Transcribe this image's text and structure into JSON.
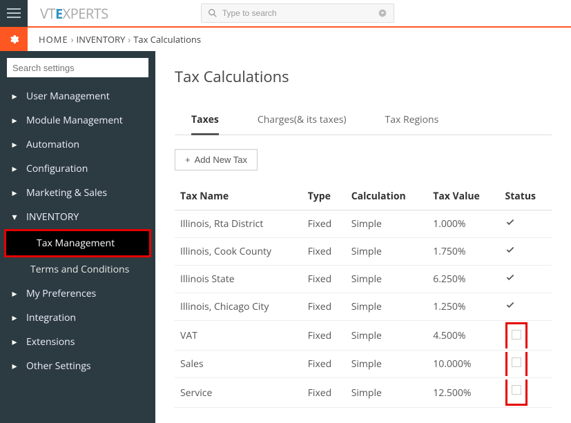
{
  "topbar": {
    "logo_pre": "VT",
    "logo_e": "E",
    "logo_post": "XPERTS",
    "search_placeholder": "Type to search"
  },
  "breadcrumb": {
    "home": "HOME",
    "l1": "INVENTORY",
    "l2": "Tax Calculations"
  },
  "sidebar": {
    "search_placeholder": "Search settings",
    "items": [
      {
        "label": "User Management",
        "expanded": false
      },
      {
        "label": "Module Management",
        "expanded": false
      },
      {
        "label": "Automation",
        "expanded": false
      },
      {
        "label": "Configuration",
        "expanded": false
      },
      {
        "label": "Marketing & Sales",
        "expanded": false
      },
      {
        "label": "INVENTORY",
        "expanded": true,
        "children": [
          {
            "label": "Tax Management",
            "active": true
          },
          {
            "label": "Terms and Conditions",
            "active": false
          }
        ]
      },
      {
        "label": "My Preferences",
        "expanded": false
      },
      {
        "label": "Integration",
        "expanded": false
      },
      {
        "label": "Extensions",
        "expanded": false
      },
      {
        "label": "Other Settings",
        "expanded": false
      }
    ]
  },
  "page": {
    "title": "Tax Calculations",
    "tabs": [
      {
        "label": "Taxes",
        "active": true
      },
      {
        "label": "Charges(& its taxes)",
        "active": false
      },
      {
        "label": "Tax Regions",
        "active": false
      }
    ],
    "add_button": "Add New Tax",
    "columns": {
      "name": "Tax Name",
      "type": "Type",
      "calculation": "Calculation",
      "value": "Tax Value",
      "status": "Status"
    },
    "rows": [
      {
        "name": "Illinois, Rta District",
        "type": "Fixed",
        "calc": "Simple",
        "value": "1.000%",
        "status": true
      },
      {
        "name": "Illinois, Cook County",
        "type": "Fixed",
        "calc": "Simple",
        "value": "1.750%",
        "status": true
      },
      {
        "name": "Illinois State",
        "type": "Fixed",
        "calc": "Simple",
        "value": "6.250%",
        "status": true
      },
      {
        "name": "Illinois, Chicago City",
        "type": "Fixed",
        "calc": "Simple",
        "value": "1.250%",
        "status": true
      },
      {
        "name": "VAT",
        "type": "Fixed",
        "calc": "Simple",
        "value": "4.500%",
        "status": false
      },
      {
        "name": "Sales",
        "type": "Fixed",
        "calc": "Simple",
        "value": "10.000%",
        "status": false
      },
      {
        "name": "Service",
        "type": "Fixed",
        "calc": "Simple",
        "value": "12.500%",
        "status": false
      }
    ]
  }
}
